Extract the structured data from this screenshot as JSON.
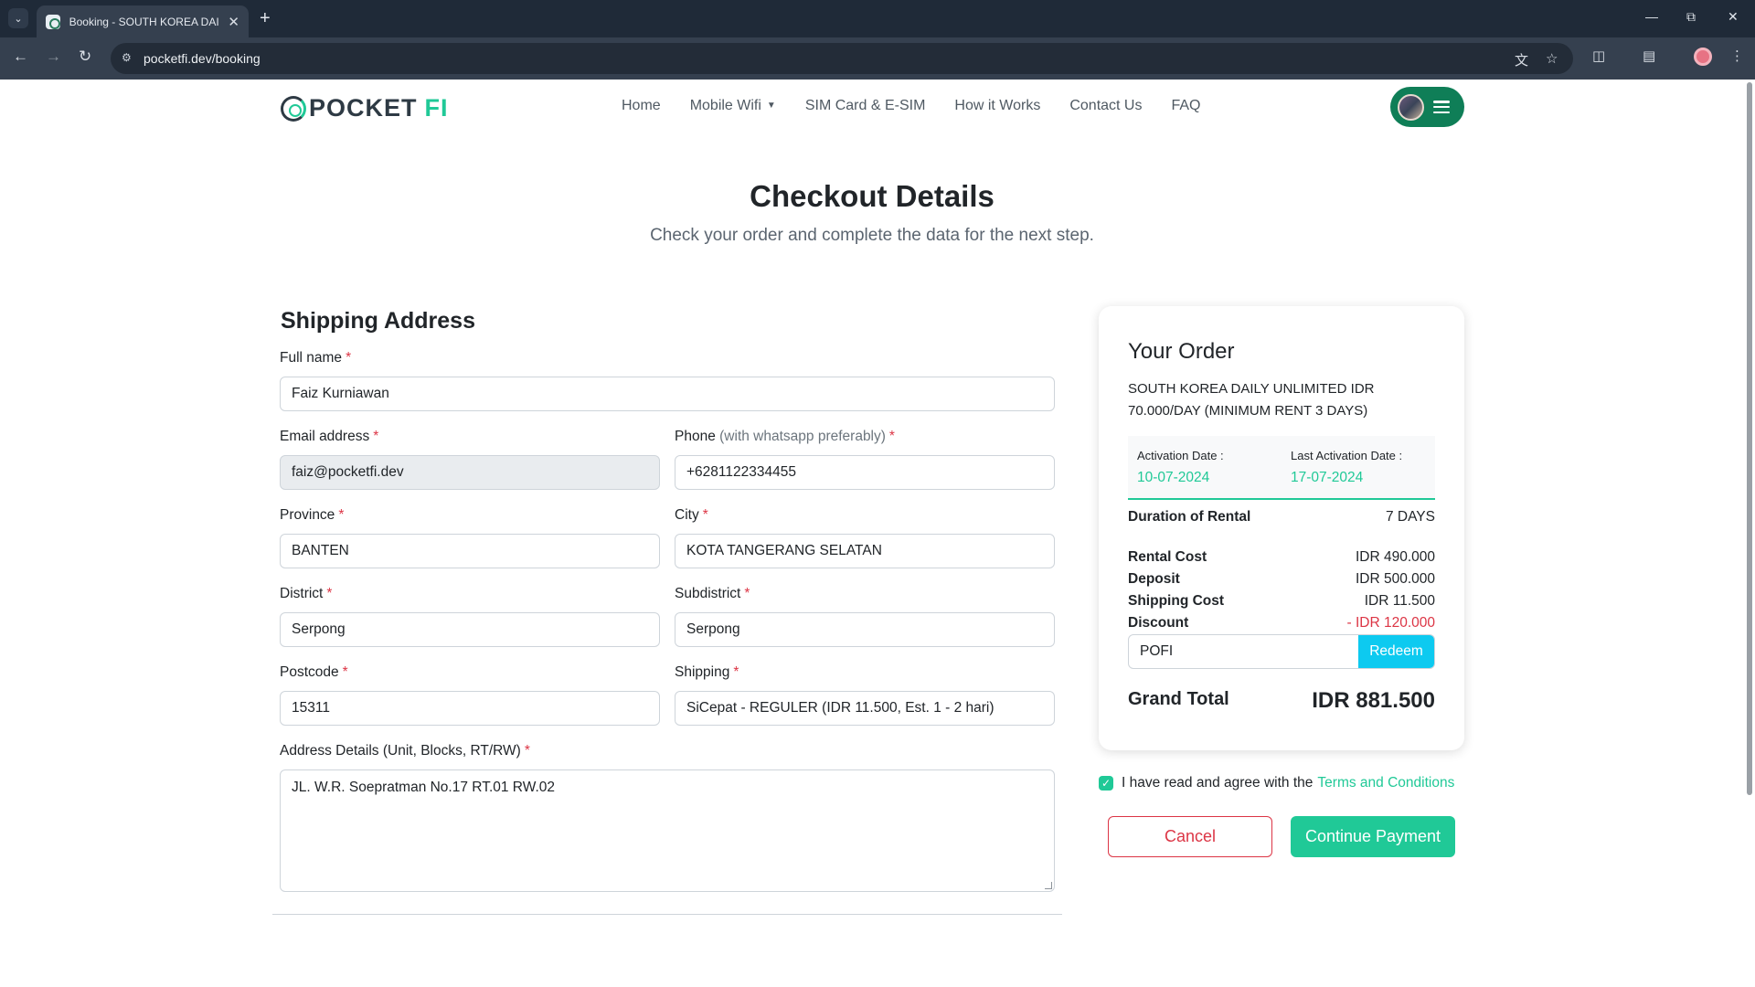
{
  "browser": {
    "tab_title": "Booking - SOUTH KOREA DAILY UNLIMITED",
    "url": "pocketfi.dev/booking"
  },
  "site": {
    "logo_text": "POCKET",
    "logo_accent": "FI",
    "nav": [
      {
        "label": "Home"
      },
      {
        "label": "Mobile Wifi"
      },
      {
        "label": "SIM Card & E-SIM"
      },
      {
        "label": "How it Works"
      },
      {
        "label": "Contact Us"
      },
      {
        "label": "FAQ"
      }
    ]
  },
  "page": {
    "title": "Checkout Details",
    "subtitle": "Check your order and complete the data for the next step."
  },
  "form": {
    "section_title": "Shipping Address",
    "full_name_label": "Full name",
    "full_name_value": "Faiz Kurniawan",
    "email_label": "Email address",
    "email_value": "faiz@pocketfi.dev",
    "phone_label": "Phone",
    "phone_hint": "(with whatsapp preferably)",
    "phone_value": "+6281122334455",
    "province_label": "Province",
    "province_value": "BANTEN",
    "city_label": "City",
    "city_value": "KOTA TANGERANG SELATAN",
    "district_label": "District",
    "district_value": "Serpong",
    "subdistrict_label": "Subdistrict",
    "subdistrict_value": "Serpong",
    "postcode_label": "Postcode",
    "postcode_value": "15311",
    "shipping_label": "Shipping",
    "shipping_value": "SiCepat - REGULER (IDR 11.500, Est. 1 - 2 hari)",
    "address_label": "Address Details (Unit, Blocks, RT/RW)",
    "address_value": "JL. W.R. Soepratman No.17 RT.01 RW.02",
    "required_mark": "*"
  },
  "order": {
    "title": "Your Order",
    "product": "SOUTH KOREA DAILY UNLIMITED IDR 70.000/DAY (MINIMUM RENT 3 DAYS)",
    "activation_label": "Activation Date :",
    "activation_value": "10-07-2024",
    "last_activation_label": "Last Activation Date :",
    "last_activation_value": "17-07-2024",
    "duration_label": "Duration of Rental",
    "duration_value": "7 DAYS",
    "rental_label": "Rental Cost",
    "rental_value": "IDR 490.000",
    "deposit_label": "Deposit",
    "deposit_value": "IDR 500.000",
    "shipping_label": "Shipping Cost",
    "shipping_value": "IDR 11.500",
    "discount_label": "Discount",
    "discount_value": "- IDR 120.000",
    "promo_code": "POFI",
    "redeem_label": "Redeem",
    "grand_total_label": "Grand Total",
    "grand_total_value": "IDR 881.500"
  },
  "agreement": {
    "text": "I have read and agree with the",
    "link": "Terms and Conditions",
    "checked": true
  },
  "actions": {
    "cancel_label": "Cancel",
    "continue_label": "Continue Payment"
  },
  "colors": {
    "accent": "#20c997",
    "danger": "#dc3545",
    "info": "#0dcaf0",
    "brand_dark": "#0f7e57"
  },
  "icons": [
    "tab-search-icon",
    "favicon-icon",
    "close-icon",
    "plus-icon",
    "minimize-icon",
    "restore-icon",
    "back-icon",
    "forward-icon",
    "reload-icon",
    "site-info-icon",
    "translate-icon",
    "star-icon",
    "extensions-icon",
    "side-panel-icon",
    "more-icon",
    "hamburger-icon",
    "caret-down-icon",
    "check-icon"
  ]
}
